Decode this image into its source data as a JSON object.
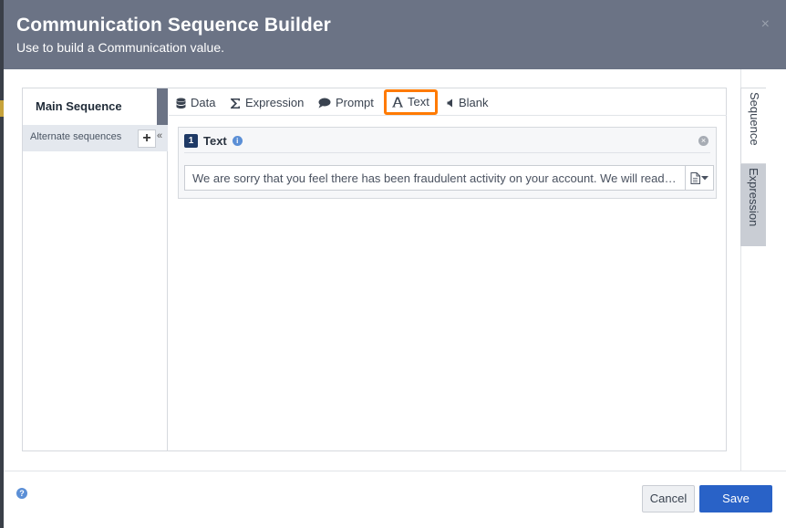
{
  "header": {
    "title": "Communication Sequence Builder",
    "subtitle": "Use to build a Communication value.",
    "close_label": "×"
  },
  "sequences": {
    "main_label": "Main Sequence",
    "alternate_label": "Alternate sequences",
    "add_label": "+",
    "collapse_label": "«"
  },
  "toolbar": {
    "items": [
      {
        "label": "Data",
        "icon": "database-icon"
      },
      {
        "label": "Expression",
        "icon": "sigma-icon"
      },
      {
        "label": "Prompt",
        "icon": "speech-bubble-icon"
      },
      {
        "label": "Text",
        "icon": "font-icon",
        "highlighted": true
      },
      {
        "label": "Blank",
        "icon": "speaker-icon"
      }
    ]
  },
  "block": {
    "number": "1",
    "title": "Text",
    "value": "We are sorry that you feel there has been fraudulent activity on your account. We will read over this information shortly."
  },
  "side_tabs": {
    "sequence": "Sequence",
    "expression": "Expression"
  },
  "footer": {
    "help_label": "?",
    "cancel_label": "Cancel",
    "save_label": "Save"
  },
  "colors": {
    "header_bg": "#6b7385",
    "highlight": "#ff7a00",
    "primary": "#2962c7"
  }
}
